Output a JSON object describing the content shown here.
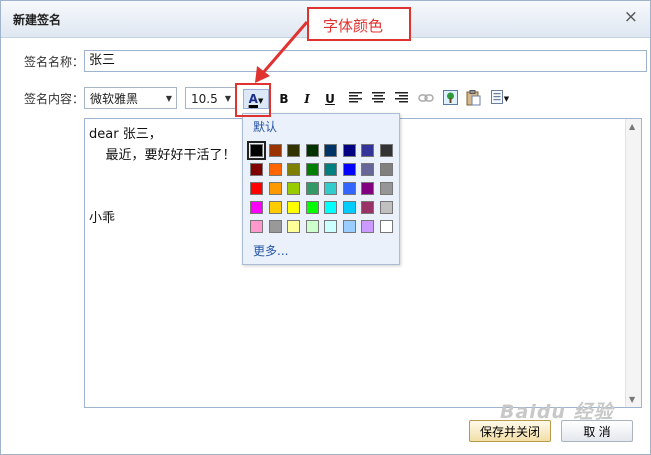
{
  "dialog": {
    "title": "新建签名",
    "close_icon": "×"
  },
  "form": {
    "name_label": "签名名称：",
    "name_value": "张三",
    "content_label": "签名内容："
  },
  "toolbar": {
    "font_family": "微软雅黑",
    "font_size": "10.5",
    "font_color_glyph": "A",
    "bold": "B",
    "italic": "I",
    "underline": "U"
  },
  "editor": {
    "lines": [
      "dear 张三，",
      "    最近，要好好干活了！",
      "小乖"
    ]
  },
  "color_palette": {
    "default_label": "默认",
    "more_label": "更多...",
    "selected": "#000000",
    "colors": [
      [
        "#000000",
        "#993300",
        "#333300",
        "#003300",
        "#003366",
        "#000080",
        "#333399",
        "#333333"
      ],
      [
        "#800000",
        "#ff6600",
        "#808000",
        "#008000",
        "#008080",
        "#0000ff",
        "#666699",
        "#808080"
      ],
      [
        "#ff0000",
        "#ff9900",
        "#99cc00",
        "#339966",
        "#33cccc",
        "#3366ff",
        "#800080",
        "#969696"
      ],
      [
        "#ff00ff",
        "#ffcc00",
        "#ffff00",
        "#00ff00",
        "#00ffff",
        "#00ccff",
        "#993366",
        "#c0c0c0"
      ],
      [
        "#ff99cc",
        "#999999",
        "#ffff99",
        "#ccffcc",
        "#ccffff",
        "#99ccff",
        "#cc99ff",
        "#ffffff"
      ]
    ]
  },
  "callout": {
    "text": "字体颜色",
    "color": "#e0322f"
  },
  "buttons": {
    "save_close": "保存并关闭",
    "cancel": "取 消"
  },
  "watermark": "Baidu 经验"
}
